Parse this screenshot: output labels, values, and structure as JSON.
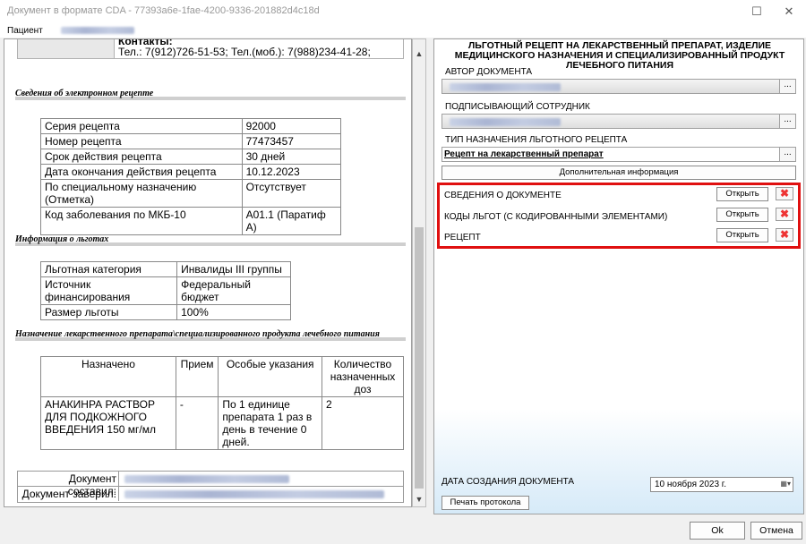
{
  "window": {
    "title": "Документ в формате CDA - 77393a6e-1fae-4200-9336-201882d4c18d",
    "minimize": "☐",
    "close": "✕"
  },
  "patient": {
    "label": "Пациент"
  },
  "document": {
    "contacts_key": "Контакты:",
    "contacts_value": "Тел.: 7(912)726-51-53; Тел.(моб.): 7(988)234-41-28;",
    "erecipe_section": "Сведения об электронном рецепте",
    "erecipe_rows": [
      [
        "Серия рецепта",
        "92000"
      ],
      [
        "Номер рецепта",
        "77473457"
      ],
      [
        "Срок действия рецепта",
        "30 дней"
      ],
      [
        "Дата окончания действия рецепта",
        "10.12.2023"
      ],
      [
        "По специальному назначению (Отметка)",
        "Отсутствует"
      ],
      [
        "Код заболевания по МКБ-10",
        "A01.1 (Паратиф A)"
      ]
    ],
    "benefits_section": "Информация о льготах",
    "benefits_rows": [
      [
        "Льготная категория",
        "Инвалиды III группы"
      ],
      [
        "Источник финансирования",
        "Федеральный бюджет"
      ],
      [
        "Размер льготы",
        "100%"
      ]
    ],
    "prescription_section": "Назначение лекарственного препарата\\специализированного продукта лечебного питания",
    "prescription_headers": [
      "Назначено",
      "Прием",
      "Особые указания",
      "Количество назначенных доз"
    ],
    "prescription_row": [
      "АНАКИНРА РАСТВОР ДЛЯ ПОДКОЖНОГО ВВЕДЕНИЯ 150 мг/мл",
      "-",
      "По 1 единице препарата 1 раз в день в течение 0 дней.",
      "2"
    ],
    "composed_by": "Документ составил:",
    "certified_by": "Документ заверил:"
  },
  "panel": {
    "heading": "ЛЬГОТНЫЙ РЕЦЕПТ НА ЛЕКАРСТВЕННЫЙ ПРЕПАРАТ, ИЗДЕЛИЕ МЕДИЦИНСКОГО НАЗНАЧЕНИЯ И СПЕЦИАЛИЗИРОВАННЫЙ ПРОДУКТ ЛЕЧЕБНОГО ПИТАНИЯ",
    "author_label": "АВТОР ДОКУМЕНТА",
    "signer_label": "ПОДПИСЫВАЮЩИЙ СОТРУДНИК",
    "type_label": "ТИП НАЗНАЧЕНИЯ ЛЬГОТНОГО РЕЦЕПТА",
    "type_value": "Рецепт на лекарственный препарат",
    "dots": "...",
    "extra_info": "Дополнительная информация",
    "sections": [
      {
        "label": "СВЕДЕНИЯ О ДОКУМЕНТЕ",
        "open": "Открыть"
      },
      {
        "label": "КОДЫ ЛЬГОТ (С КОДИРОВАННЫМИ ЭЛЕМЕНТАМИ)",
        "open": "Открыть"
      },
      {
        "label": "РЕЦЕПТ",
        "open": "Открыть"
      }
    ],
    "date_label": "ДАТА СОЗДАНИЯ ДОКУМЕНТА",
    "date_value": "10  ноября  2023 г.",
    "print_button": "Печать протокола"
  },
  "footer": {
    "ok": "Ok",
    "cancel": "Отмена"
  },
  "colors": {
    "highlight": "#e01010"
  }
}
